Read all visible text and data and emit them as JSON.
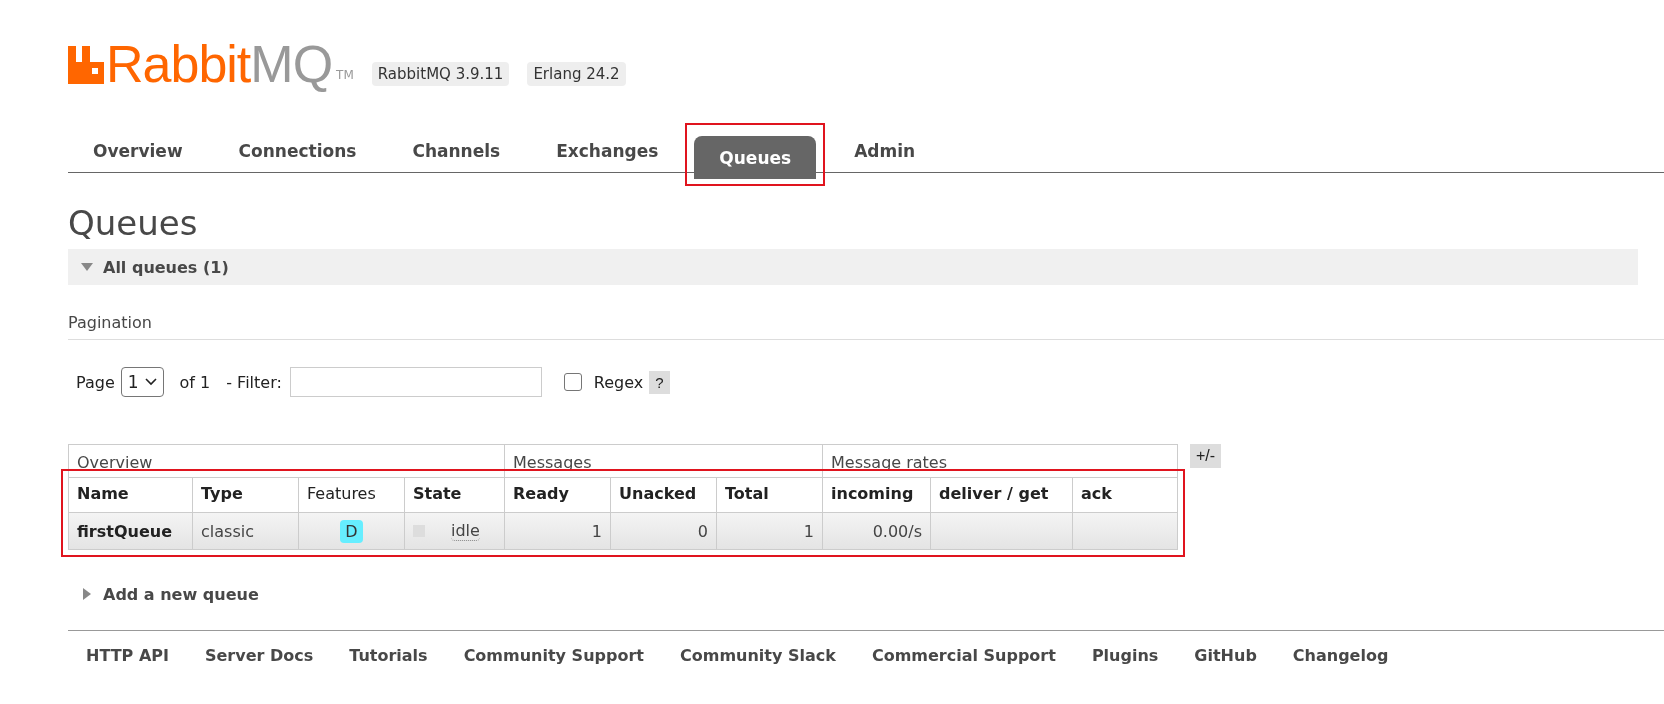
{
  "header": {
    "logo": {
      "word_1": "Rabbit",
      "word_2": "MQ",
      "trademark": "TM"
    },
    "versions": [
      "RabbitMQ 3.9.11",
      "Erlang 24.2"
    ]
  },
  "tabs": [
    {
      "label": "Overview",
      "selected": false,
      "highlighted": false
    },
    {
      "label": "Connections",
      "selected": false,
      "highlighted": false
    },
    {
      "label": "Channels",
      "selected": false,
      "highlighted": false
    },
    {
      "label": "Exchanges",
      "selected": false,
      "highlighted": false
    },
    {
      "label": "Queues",
      "selected": true,
      "highlighted": true
    },
    {
      "label": "Admin",
      "selected": false,
      "highlighted": false
    }
  ],
  "page_title": "Queues",
  "all_queues": {
    "label": "All queues (1)",
    "expanded": true
  },
  "pagination": {
    "title": "Pagination",
    "page_label": "Page",
    "page_value": "1",
    "of_label": "of 1",
    "filter_label": "- Filter:",
    "regex_label": "Regex",
    "regex_checked": false,
    "help": "?"
  },
  "table": {
    "highlighted": true,
    "toggle": "+/-",
    "groups": [
      {
        "label": "Overview"
      },
      {
        "label": "Messages"
      },
      {
        "label": "Message rates"
      }
    ],
    "columns": [
      "Name",
      "Type",
      "Features",
      "State",
      "Ready",
      "Unacked",
      "Total",
      "incoming",
      "deliver / get",
      "ack"
    ],
    "rows": [
      {
        "name": "firstQueue",
        "type": "classic",
        "features": "D",
        "state": "idle",
        "ready": "1",
        "unacked": "0",
        "total": "1",
        "incoming": "0.00/s"
      }
    ]
  },
  "add_queue": {
    "label": "Add a new queue",
    "expanded": false
  },
  "footer": [
    "HTTP API",
    "Server Docs",
    "Tutorials",
    "Community Support",
    "Community Slack",
    "Commercial Support",
    "Plugins",
    "GitHub",
    "Changelog"
  ]
}
